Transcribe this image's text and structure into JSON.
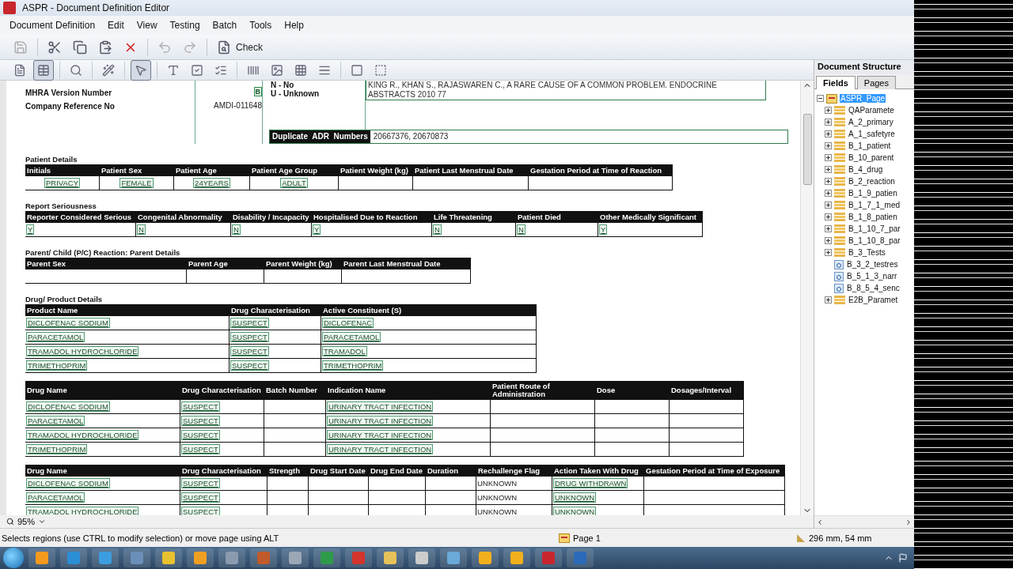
{
  "window": {
    "title": "ASPR - Document Definition Editor"
  },
  "menu": [
    "Document Definition",
    "Edit",
    "View",
    "Testing",
    "Batch",
    "Tools",
    "Help"
  ],
  "toolbar": [
    {
      "kind": "save",
      "disabled": true
    },
    {
      "kind": "cut",
      "disabled": false
    },
    {
      "kind": "copy",
      "disabled": false
    },
    {
      "kind": "paste",
      "disabled": false
    },
    {
      "kind": "delete",
      "disabled": false
    },
    {
      "kind": "undo",
      "disabled": true
    },
    {
      "kind": "redo",
      "disabled": true
    },
    {
      "kind": "check",
      "label": "Check",
      "disabled": false
    }
  ],
  "tools": [
    {
      "kind": "page",
      "selected": false
    },
    {
      "kind": "table",
      "selected": true
    },
    {
      "kind": "zoom",
      "selected": false
    },
    {
      "kind": "magic",
      "selected": false
    },
    {
      "kind": "pointer",
      "selected": true
    },
    {
      "kind": "text",
      "selected": false
    },
    {
      "kind": "checkbox",
      "selected": false
    },
    {
      "kind": "checklist",
      "selected": false
    },
    {
      "kind": "barcode",
      "selected": false
    },
    {
      "kind": "image",
      "selected": false
    },
    {
      "kind": "grid",
      "selected": false
    },
    {
      "kind": "lines",
      "selected": false
    },
    {
      "kind": "shape",
      "selected": false
    },
    {
      "kind": "hatch",
      "selected": false
    }
  ],
  "record": {
    "labels": [
      "MHRA Version Number",
      "Company Reference No"
    ],
    "value": "AMDI-011648",
    "field_mark": "B",
    "outcome_key": [
      "N - No",
      "U - Unknown"
    ],
    "reference": "KING R., KHAN S., RAJASWAREN C., A RARE CAUSE OF A COMMON PROBLEM. ENDOCRINE ABSTRACTS 2010 77",
    "duplicate": {
      "label": "Duplicate  ADR  Numbers",
      "value": "20667376, 20670873"
    }
  },
  "sections": [
    {
      "title": "Patient Details",
      "columns": [
        "Initials",
        "Patient Sex",
        "Patient Age",
        "Patient Age Group",
        "Patient Weight (kg)",
        "Patient Last Menstrual Date",
        "Gestation Period at Time of Reaction"
      ],
      "rows": [
        [
          {
            "text": "PRIVACY",
            "field": true
          },
          {
            "text": "FEMALE",
            "field": true
          },
          {
            "text": "24YEARS",
            "field": true
          },
          {
            "text": "ADULT",
            "field": true
          },
          null,
          null,
          null
        ]
      ]
    },
    {
      "title": "Report Seriousness",
      "columns": [
        "Reporter Considered Serious",
        "Congenital Abnormality",
        "Disability / Incapacity",
        "Hospitalised Due to Reaction",
        "Life Threatening",
        "Patient Died",
        "Other Medically Significant"
      ],
      "rows": [
        [
          {
            "text": "Y",
            "field": true
          },
          {
            "text": "N",
            "field": true
          },
          {
            "text": "N",
            "field": true
          },
          {
            "text": "Y",
            "field": true
          },
          {
            "text": "N",
            "field": true
          },
          {
            "text": "N",
            "field": true
          },
          {
            "text": "Y",
            "field": true
          }
        ]
      ]
    },
    {
      "title": "Parent/ Child (P/C) Reaction: Parent Details",
      "columns": [
        "Parent Sex",
        "Parent Age",
        "Parent Weight (kg)",
        "Parent Last Menstrual Date"
      ],
      "rows": [
        [
          null,
          null,
          null,
          null
        ]
      ]
    },
    {
      "title": "Drug/ Product Details",
      "columns": [
        "Product Name",
        "Drug Characterisation",
        "Active Constituent (S)"
      ],
      "rows": [
        [
          {
            "text": "DICLOFENAC SODIUM",
            "field": true
          },
          {
            "text": "SUSPECT",
            "field": true
          },
          {
            "text": "DICLOFENAC",
            "field": true
          }
        ],
        [
          {
            "text": "PARACETAMOL",
            "field": true
          },
          {
            "text": "SUSPECT",
            "field": true
          },
          {
            "text": "PARACETAMOL",
            "field": true
          }
        ],
        [
          {
            "text": "TRAMADOL HYDROCHLORIDE",
            "field": true
          },
          {
            "text": "SUSPECT",
            "field": true
          },
          {
            "text": "TRAMADOL",
            "field": true
          }
        ],
        [
          {
            "text": "TRIMETHOPRIM",
            "field": true
          },
          {
            "text": "SUSPECT",
            "field": true
          },
          {
            "text": "TRIMETHOPRIM",
            "field": true
          }
        ]
      ]
    },
    {
      "columns": [
        "Drug Name",
        "Drug Characterisation",
        "Batch Number",
        "Indication Name",
        "Patient Route of Administration",
        "Dose",
        "Dosages/Interval"
      ],
      "rows": [
        [
          {
            "text": "DICLOFENAC SODIUM",
            "field": true
          },
          {
            "text": "SUSPECT",
            "field": true
          },
          null,
          {
            "text": "URINARY TRACT INFECTION",
            "field": true
          },
          null,
          null,
          null
        ],
        [
          {
            "text": "PARACETAMOL",
            "field": true
          },
          {
            "text": "SUSPECT",
            "field": true
          },
          null,
          {
            "text": "URINARY TRACT INFECTION",
            "field": true
          },
          null,
          null,
          null
        ],
        [
          {
            "text": "TRAMADOL HYDROCHLORIDE",
            "field": true
          },
          {
            "text": "SUSPECT",
            "field": true
          },
          null,
          {
            "text": "URINARY TRACT INFECTION",
            "field": true
          },
          null,
          null,
          null
        ],
        [
          {
            "text": "TRIMETHOPRIM",
            "field": true
          },
          {
            "text": "SUSPECT",
            "field": true
          },
          null,
          {
            "text": "URINARY TRACT INFECTION",
            "field": true
          },
          null,
          null,
          null
        ]
      ]
    },
    {
      "columns": [
        "Drug Name",
        "Drug Characterisation",
        "Strength",
        "Drug Start Date",
        "Drug End Date",
        "Duration",
        "Rechallenge Flag",
        "Action Taken With Drug",
        "Gestation Period at Time of Exposure"
      ],
      "rows": [
        [
          {
            "text": "DICLOFENAC SODIUM",
            "field": true
          },
          {
            "text": "SUSPECT",
            "field": true
          },
          null,
          null,
          null,
          null,
          {
            "text": "UNKNOWN",
            "field": false
          },
          {
            "text": "DRUG WITHDRAWN",
            "field": true
          },
          null
        ],
        [
          {
            "text": "PARACETAMOL",
            "field": true
          },
          {
            "text": "SUSPECT",
            "field": true
          },
          null,
          null,
          null,
          null,
          {
            "text": "UNKNOWN",
            "field": false
          },
          {
            "text": "UNKNOWN",
            "field": true
          },
          null
        ],
        [
          {
            "text": "TRAMADOL HYDROCHLORIDE",
            "field": true
          },
          {
            "text": "SUSPECT",
            "field": true
          },
          null,
          null,
          null,
          null,
          {
            "text": "UNKNOWN",
            "field": false
          },
          {
            "text": "UNKNOWN",
            "field": true
          },
          null
        ]
      ]
    }
  ],
  "zoom": "95%",
  "panel": {
    "title": "Document Structure",
    "tabs": [
      {
        "label": "Fields",
        "selected": true
      },
      {
        "label": "Pages",
        "selected": false
      }
    ],
    "tree": [
      {
        "label": "ASPR_Page",
        "kind": "page",
        "expanded": true,
        "selected": true,
        "children": [
          {
            "label": "QAParamete",
            "kind": "folder",
            "expanded": false,
            "selected": false
          },
          {
            "label": "A_2_primary",
            "kind": "folder",
            "expanded": false,
            "selected": false
          },
          {
            "label": "A_1_safetyre",
            "kind": "folder",
            "expanded": false,
            "selected": false
          },
          {
            "label": "B_1_patient",
            "kind": "folder",
            "expanded": false,
            "selected": false
          },
          {
            "label": "B_10_parent",
            "kind": "folder",
            "expanded": false,
            "selected": false
          },
          {
            "label": "B_4_drug",
            "kind": "folder",
            "expanded": false,
            "selected": false
          },
          {
            "label": "B_2_reaction",
            "kind": "folder",
            "expanded": false,
            "selected": false
          },
          {
            "label": "B_1_9_patien",
            "kind": "folder",
            "expanded": false,
            "selected": false
          },
          {
            "label": "B_1_7_1_med",
            "kind": "folder",
            "expanded": false,
            "selected": false
          },
          {
            "label": "B_1_8_patien",
            "kind": "folder",
            "expanded": false,
            "selected": false
          },
          {
            "label": "B_1_10_7_par",
            "kind": "folder",
            "expanded": false,
            "selected": false
          },
          {
            "label": "B_1_10_8_par",
            "kind": "folder",
            "expanded": false,
            "selected": false
          },
          {
            "label": "B_3_Tests",
            "kind": "folder",
            "expanded": false,
            "selected": false
          },
          {
            "label": "B_3_2_testres",
            "kind": "field",
            "selected": false
          },
          {
            "label": "B_5_1_3_narr",
            "kind": "field",
            "selected": false
          },
          {
            "label": "B_8_5_4_senc",
            "kind": "field",
            "selected": false
          },
          {
            "label": "E2B_Paramet",
            "kind": "folder",
            "expanded": false,
            "selected": false
          }
        ]
      }
    ]
  },
  "status_bar": {
    "message": "Selects regions (use CTRL to modify selection) or move page using ALT",
    "page": "Page 1",
    "position": "296 mm, 54 mm"
  }
}
